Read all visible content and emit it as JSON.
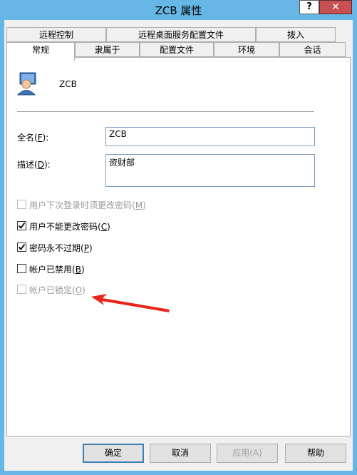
{
  "window": {
    "title": "ZCB 属性",
    "help_label": "?",
    "close_label": "✕"
  },
  "tabs_row_back": [
    {
      "label": "远程控制"
    },
    {
      "label": "远程桌面服务配置文件"
    },
    {
      "label": "拨入"
    }
  ],
  "tabs_row_front": [
    {
      "label": "常规"
    },
    {
      "label": "隶属于"
    },
    {
      "label": "配置文件"
    },
    {
      "label": "环境"
    },
    {
      "label": "会话"
    }
  ],
  "general": {
    "user_icon": "user-icon",
    "user_name": "ZCB",
    "fullname": {
      "label": "全名",
      "hotkey": "F",
      "value": "ZCB"
    },
    "description": {
      "label": "描述",
      "hotkey": "D",
      "value": "资财部"
    },
    "options": [
      {
        "label": "用户下次登录时须更改密码",
        "hotkey": "M",
        "checked": false,
        "disabled": true
      },
      {
        "label": "用户不能更改密码",
        "hotkey": "C",
        "checked": true,
        "disabled": false
      },
      {
        "label": "密码永不过期",
        "hotkey": "P",
        "checked": true,
        "disabled": false
      },
      {
        "label": "帐户已禁用",
        "hotkey": "B",
        "checked": false,
        "disabled": false
      },
      {
        "label": "帐户已锁定",
        "hotkey": "O",
        "checked": false,
        "disabled": true
      }
    ]
  },
  "buttons": {
    "ok": "确定",
    "cancel": "取消",
    "apply": "应用(A)",
    "help": "帮助"
  },
  "colors": {
    "annotation_arrow": "#e8261c",
    "title_bar": "#66b7e6",
    "close_button": "#c75050"
  }
}
